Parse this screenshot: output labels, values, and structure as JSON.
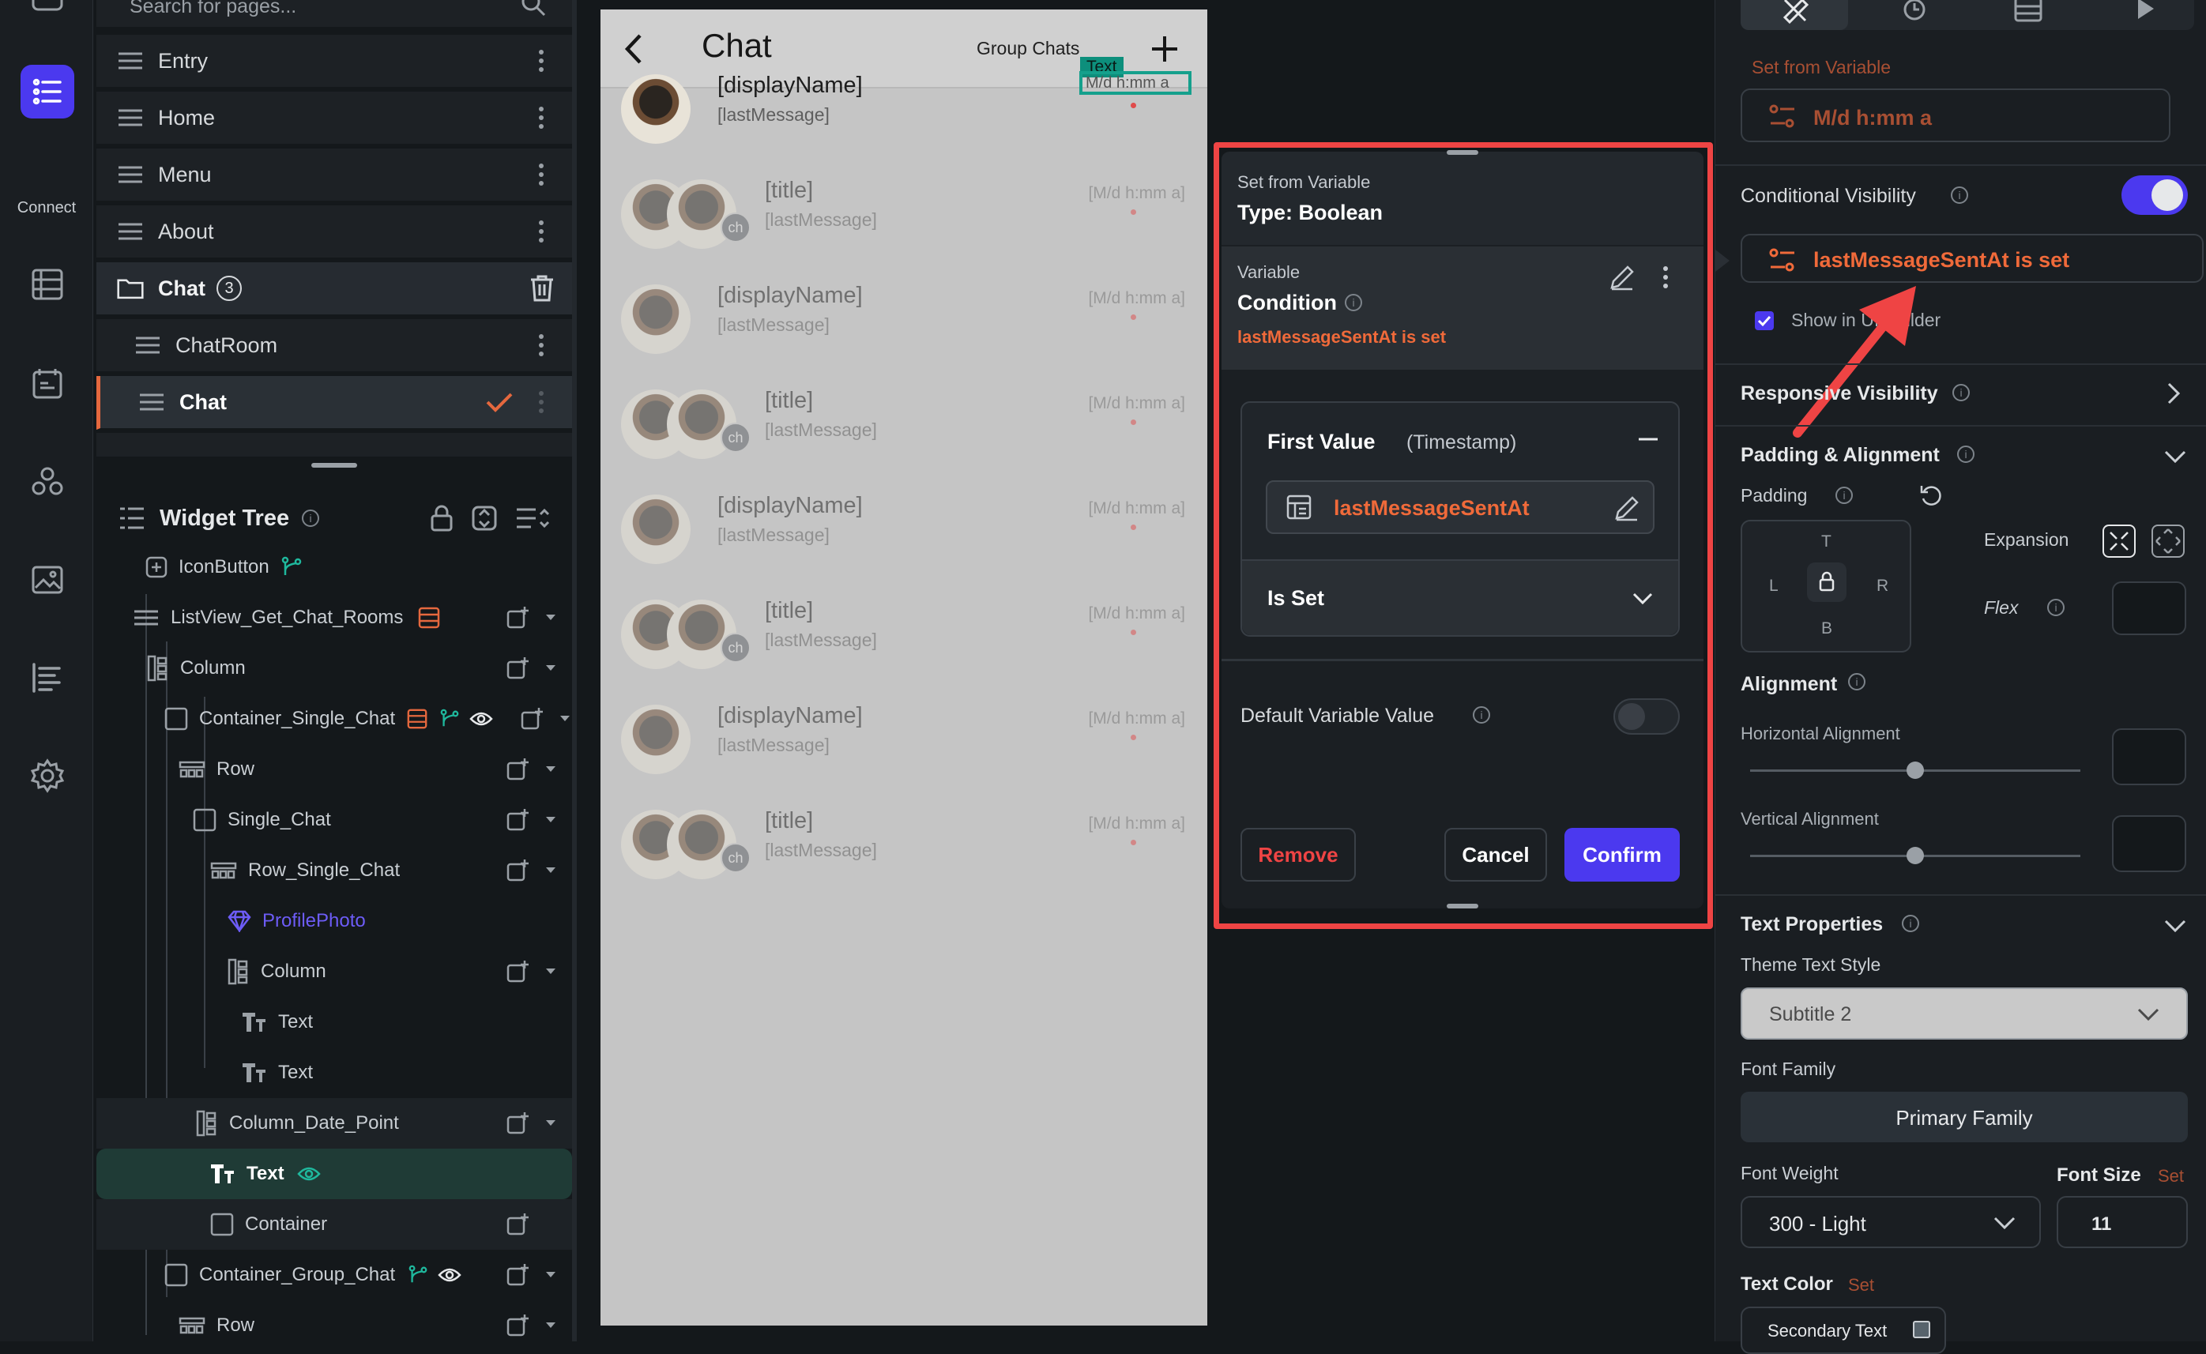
{
  "rail": {
    "connect_label": "Connect"
  },
  "pages": {
    "search_placeholder": "Search for pages...",
    "items": [
      {
        "label": "Entry"
      },
      {
        "label": "Home"
      },
      {
        "label": "Menu"
      },
      {
        "label": "About"
      }
    ],
    "folder": {
      "label": "Chat",
      "count": "3"
    },
    "children": [
      {
        "label": "ChatRoom"
      },
      {
        "label": "Chat"
      }
    ]
  },
  "widget_tree": {
    "title": "Widget Tree",
    "nodes": [
      {
        "label": "IconButton"
      },
      {
        "label": "ListView_Get_Chat_Rooms"
      },
      {
        "label": "Column"
      },
      {
        "label": "Container_Single_Chat"
      },
      {
        "label": "Row"
      },
      {
        "label": "Single_Chat"
      },
      {
        "label": "Row_Single_Chat"
      },
      {
        "label": "ProfilePhoto"
      },
      {
        "label": "Column"
      },
      {
        "label": "Text"
      },
      {
        "label": "Text"
      },
      {
        "label": "Column_Date_Point"
      },
      {
        "label": "Text"
      },
      {
        "label": "Container"
      },
      {
        "label": "Container_Group_Chat"
      },
      {
        "label": "Row"
      }
    ]
  },
  "phone": {
    "title": "Chat",
    "group_chats": "Group Chats",
    "text_tag": "Text",
    "rows": [
      {
        "name": "[displayName]",
        "last": "[lastMessage]",
        "time": "M/d h:mm a",
        "group": false
      },
      {
        "name": "[title]",
        "last": "[lastMessage]",
        "time": "[M/d h:mm a]",
        "group": true
      },
      {
        "name": "[displayName]",
        "last": "[lastMessage]",
        "time": "[M/d h:mm a]",
        "group": false
      },
      {
        "name": "[title]",
        "last": "[lastMessage]",
        "time": "[M/d h:mm a]",
        "group": true
      },
      {
        "name": "[displayName]",
        "last": "[lastMessage]",
        "time": "[M/d h:mm a]",
        "group": false
      },
      {
        "name": "[title]",
        "last": "[lastMessage]",
        "time": "[M/d h:mm a]",
        "group": true
      },
      {
        "name": "[displayName]",
        "last": "[lastMessage]",
        "time": "[M/d h:mm a]",
        "group": false
      },
      {
        "name": "[title]",
        "last": "[lastMessage]",
        "time": "[M/d h:mm a]",
        "group": true
      }
    ],
    "ch_badge": "ch"
  },
  "dialog": {
    "set_from_variable": "Set from Variable",
    "type": "Type: Boolean",
    "variable_label": "Variable",
    "condition_label": "Condition",
    "condition_value": "lastMessageSentAt is set",
    "first_value": "First Value",
    "first_value_type": "(Timestamp)",
    "first_value_name": "lastMessageSentAt",
    "operator": "Is Set",
    "default_variable_value": "Default Variable Value",
    "remove": "Remove",
    "cancel": "Cancel",
    "confirm": "Confirm"
  },
  "props": {
    "set_from_variable": "Set from Variable",
    "variable_value": "M/d h:mm a",
    "conditional_visibility": "Conditional Visibility",
    "condition_value": "lastMessageSentAt is set",
    "show_in_ui_builder": "Show in UI Builder",
    "responsive_visibility": "Responsive Visibility",
    "padding_alignment": "Padding & Alignment",
    "padding": "Padding",
    "pad_t": "T",
    "pad_l": "L",
    "pad_r": "R",
    "pad_b": "B",
    "expansion": "Expansion",
    "flex": "Flex",
    "alignment": "Alignment",
    "horizontal_alignment": "Horizontal Alignment",
    "vertical_alignment": "Vertical Alignment",
    "text_properties": "Text Properties",
    "theme_text_style": "Theme Text Style",
    "theme_text_style_value": "Subtitle 2",
    "font_family": "Font Family",
    "font_family_value": "Primary Family",
    "font_weight": "Font Weight",
    "font_weight_value": "300 - Light",
    "font_size": "Font Size",
    "font_size_set": "Set",
    "font_size_value": "11",
    "text_color": "Text Color",
    "text_color_set": "Set",
    "text_color_value": "Secondary Text"
  },
  "colors": {
    "accent": "#4b39ef",
    "orange": "#f06a3a",
    "highlight_red": "#ef4444",
    "teal": "#15a08c"
  }
}
